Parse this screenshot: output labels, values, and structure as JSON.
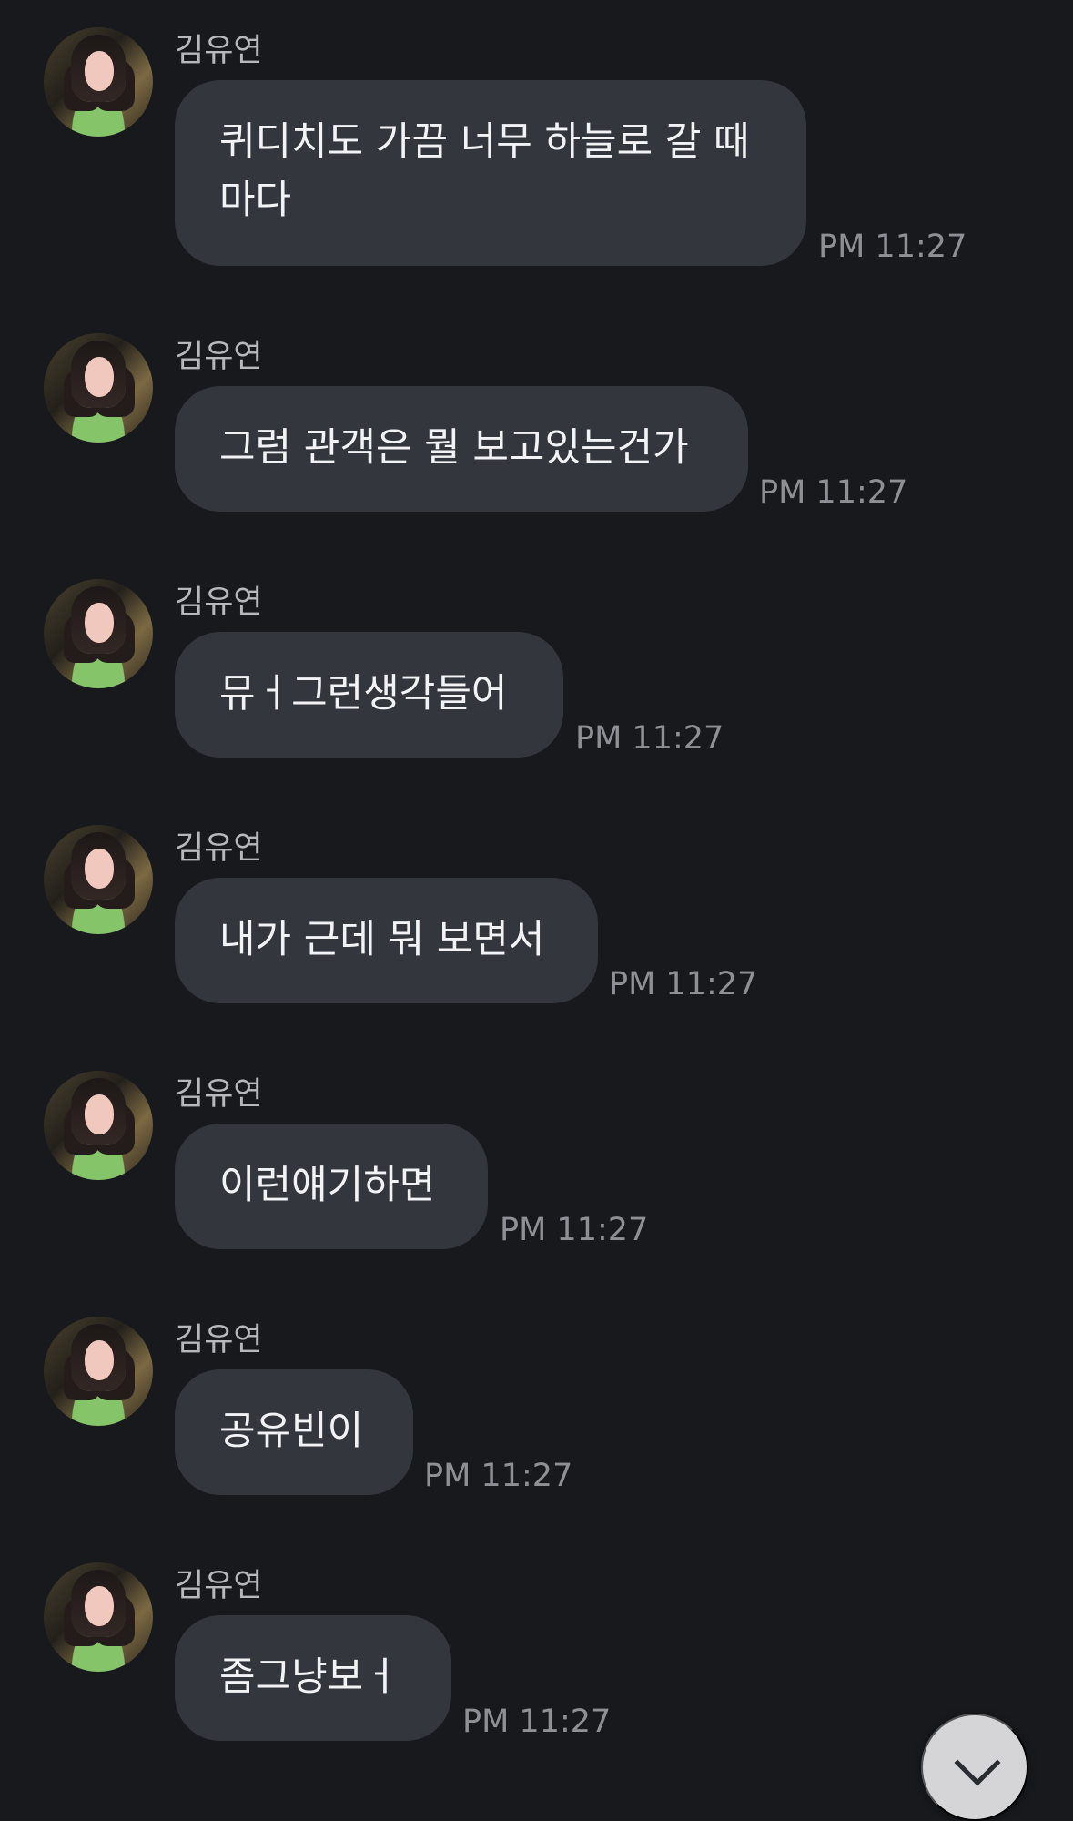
{
  "messages": [
    {
      "sender": "김유연",
      "text": "퀴디치도 가끔 너무 하늘로 갈 때\n마다",
      "time": "PM 11:27"
    },
    {
      "sender": "김유연",
      "text": "그럼 관객은 뭘 보고있는건가",
      "time": "PM 11:27"
    },
    {
      "sender": "김유연",
      "text": "뮤ㅓ그런생각들어",
      "time": "PM 11:27"
    },
    {
      "sender": "김유연",
      "text": "내가 근데 뭐 보면서",
      "time": "PM 11:27"
    },
    {
      "sender": "김유연",
      "text": "이런얘기하면",
      "time": "PM 11:27"
    },
    {
      "sender": "김유연",
      "text": "공유빈이",
      "time": "PM 11:27"
    },
    {
      "sender": "김유연",
      "text": "좀그냥보ㅓ",
      "time": "PM 11:27"
    }
  ],
  "icons": {
    "avatar": "profile-photo",
    "scroll_down": "chevron-down-icon"
  },
  "colors": {
    "background": "#18191d",
    "bubble": "#34363d",
    "text": "#f3f3f5",
    "sender": "#b7b8be",
    "time": "#8f9096",
    "scroll_button": "#d5d5d8"
  }
}
